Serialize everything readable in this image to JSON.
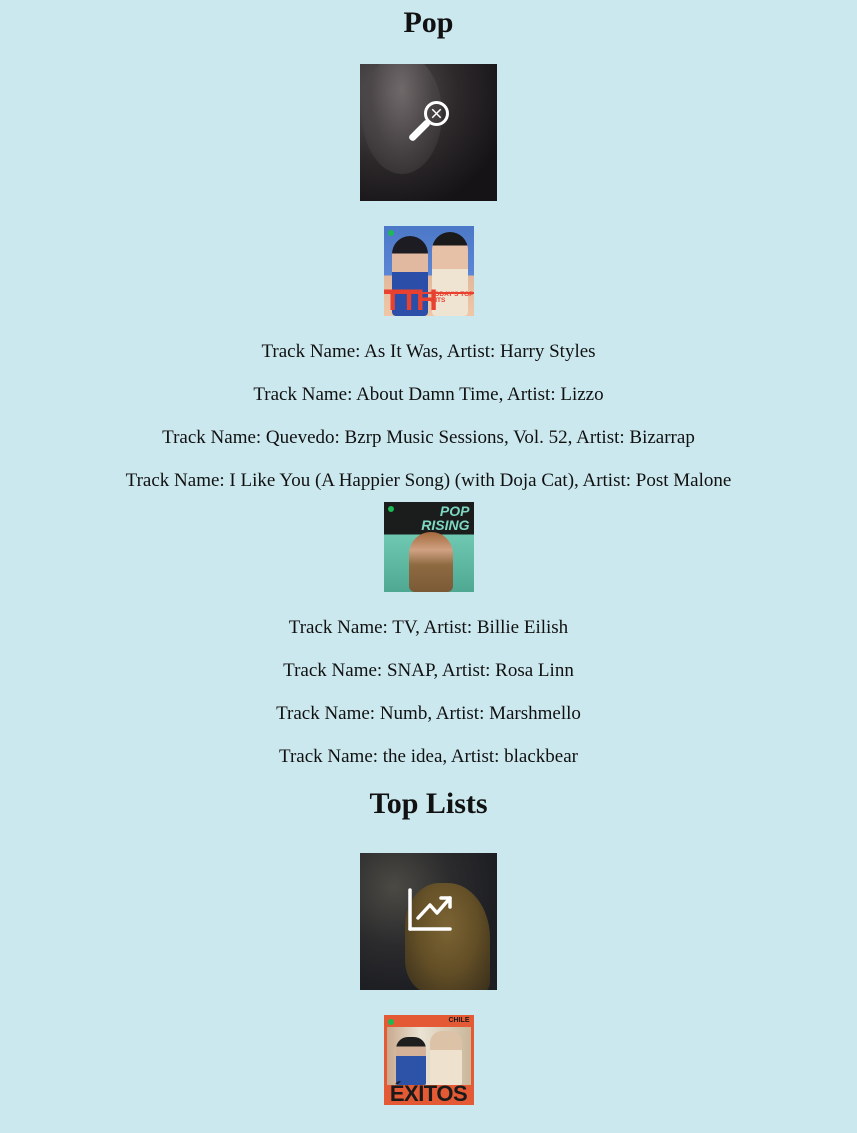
{
  "categories": [
    {
      "title": "Pop",
      "image_icon": "microphone-icon",
      "playlists": [
        {
          "cover_text_big": "TTH",
          "cover_text_small": "TODAY'S TOP HITS",
          "tracks": [
            "Track Name: As It Was, Artist: Harry Styles",
            "Track Name: About Damn Time, Artist: Lizzo",
            "Track Name: Quevedo: Bzrp Music Sessions, Vol. 52, Artist: Bizarrap",
            "Track Name: I Like You (A Happier Song) (with Doja Cat), Artist: Post Malone"
          ]
        },
        {
          "cover_text_big": "POP RISING",
          "tracks": [
            "Track Name: TV, Artist: Billie Eilish",
            "Track Name: SNAP, Artist: Rosa Linn",
            "Track Name: Numb, Artist: Marshmello",
            "Track Name: the idea, Artist: blackbear"
          ]
        }
      ]
    },
    {
      "title": "Top Lists",
      "image_icon": "trending-up-icon",
      "playlists": [
        {
          "cover_text_small": "CHILE",
          "cover_text_big": "ÉXITOS"
        }
      ]
    }
  ],
  "colors": {
    "background": "#cbe8ee",
    "text": "#111111"
  }
}
